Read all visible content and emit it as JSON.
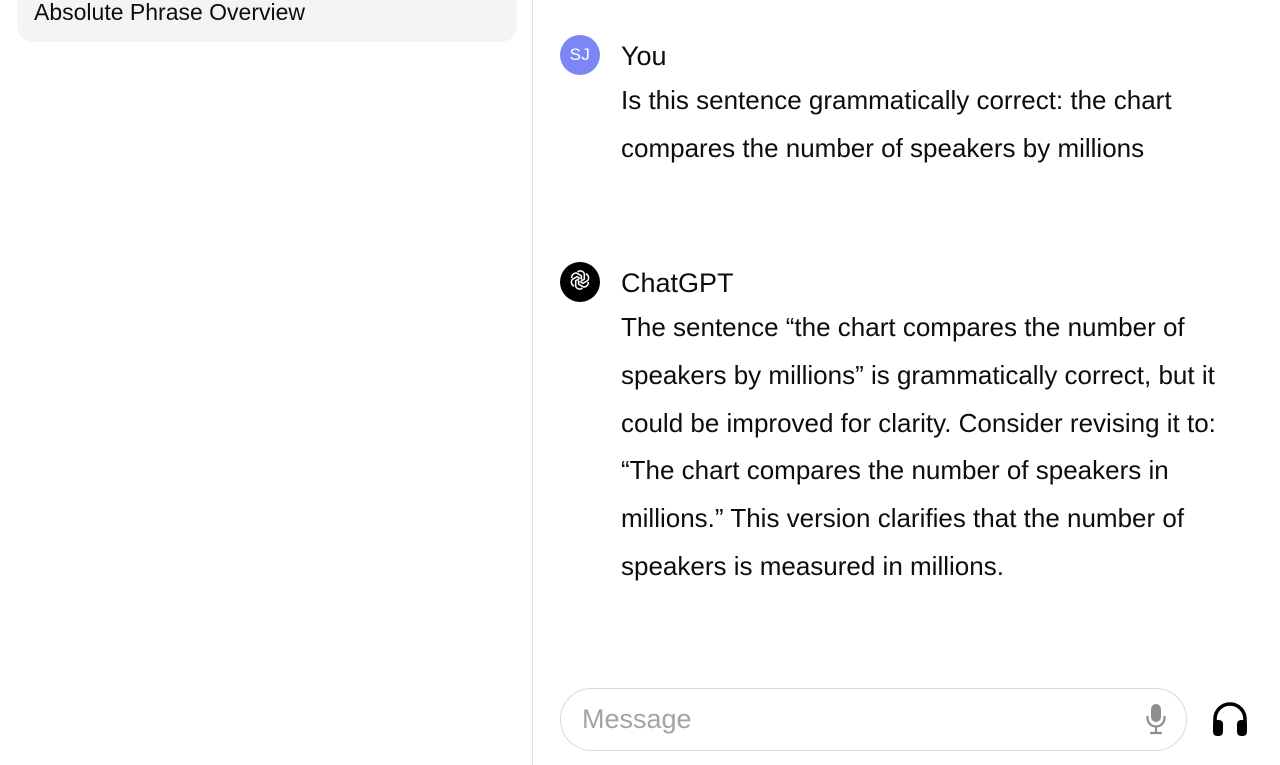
{
  "sidebar": {
    "conversations": [
      {
        "title": "Absolute Phrase Overview"
      }
    ]
  },
  "chat": {
    "messages": [
      {
        "author": "You",
        "avatar_initials": "SJ",
        "avatar_color": "#7c87f5",
        "text": "Is this sentence grammatically correct: the chart compares the number of speakers by millions"
      },
      {
        "author": "ChatGPT",
        "avatar_icon": "openai-logo-icon",
        "text": "The sentence “the chart compares the number of speakers by millions” is grammatically correct, but it could be improved for clarity. Consider revising it to: “The chart compares the number of speakers in millions.” This version clarifies that the number of speakers is measured in millions."
      }
    ]
  },
  "composer": {
    "placeholder": "Message",
    "value": "",
    "mic_icon": "microphone-icon",
    "voice_icon": "headphones-icon"
  }
}
